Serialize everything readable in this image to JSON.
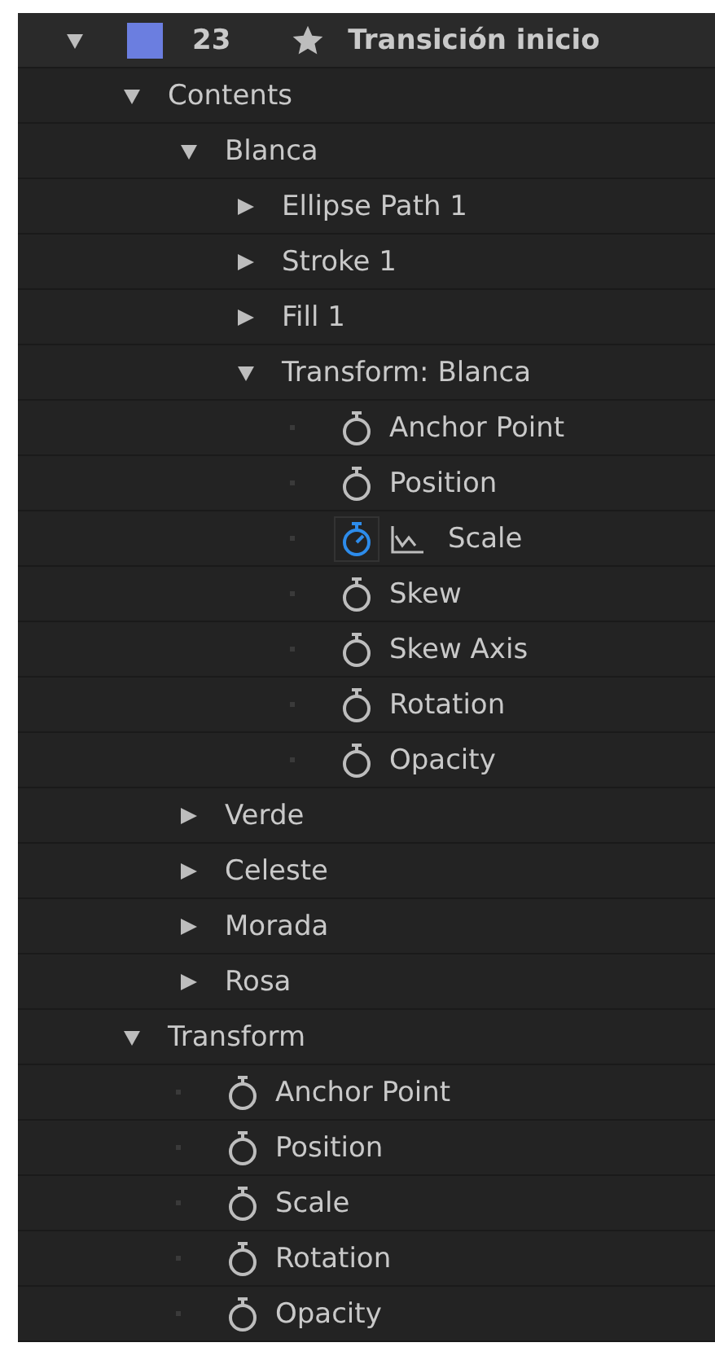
{
  "layer": {
    "expanded": true,
    "color": "#6b7ee0",
    "number": "23",
    "name": "Transición inicio",
    "children": [
      {
        "kind": "group",
        "label": "Contents",
        "expanded": true,
        "children": [
          {
            "kind": "group",
            "label": "Blanca",
            "expanded": true,
            "children": [
              {
                "kind": "group",
                "label": "Ellipse Path 1",
                "expanded": false
              },
              {
                "kind": "group",
                "label": "Stroke 1",
                "expanded": false
              },
              {
                "kind": "group",
                "label": "Fill 1",
                "expanded": false
              },
              {
                "kind": "group",
                "label": "Transform: Blanca",
                "expanded": true,
                "children": [
                  {
                    "kind": "property",
                    "label": "Anchor Point",
                    "animated": false
                  },
                  {
                    "kind": "property",
                    "label": "Position",
                    "animated": false
                  },
                  {
                    "kind": "property",
                    "label": "Scale",
                    "animated": true
                  },
                  {
                    "kind": "property",
                    "label": "Skew",
                    "animated": false
                  },
                  {
                    "kind": "property",
                    "label": "Skew Axis",
                    "animated": false
                  },
                  {
                    "kind": "property",
                    "label": "Rotation",
                    "animated": false
                  },
                  {
                    "kind": "property",
                    "label": "Opacity",
                    "animated": false
                  }
                ]
              }
            ]
          },
          {
            "kind": "group",
            "label": "Verde",
            "expanded": false
          },
          {
            "kind": "group",
            "label": "Celeste",
            "expanded": false
          },
          {
            "kind": "group",
            "label": "Morada",
            "expanded": false
          },
          {
            "kind": "group",
            "label": "Rosa",
            "expanded": false
          }
        ]
      },
      {
        "kind": "group",
        "label": "Transform",
        "expanded": true,
        "children": [
          {
            "kind": "property",
            "label": "Anchor Point",
            "animated": false
          },
          {
            "kind": "property",
            "label": "Position",
            "animated": false
          },
          {
            "kind": "property",
            "label": "Scale",
            "animated": false
          },
          {
            "kind": "property",
            "label": "Rotation",
            "animated": false
          },
          {
            "kind": "property",
            "label": "Opacity",
            "animated": false
          }
        ]
      }
    ]
  }
}
